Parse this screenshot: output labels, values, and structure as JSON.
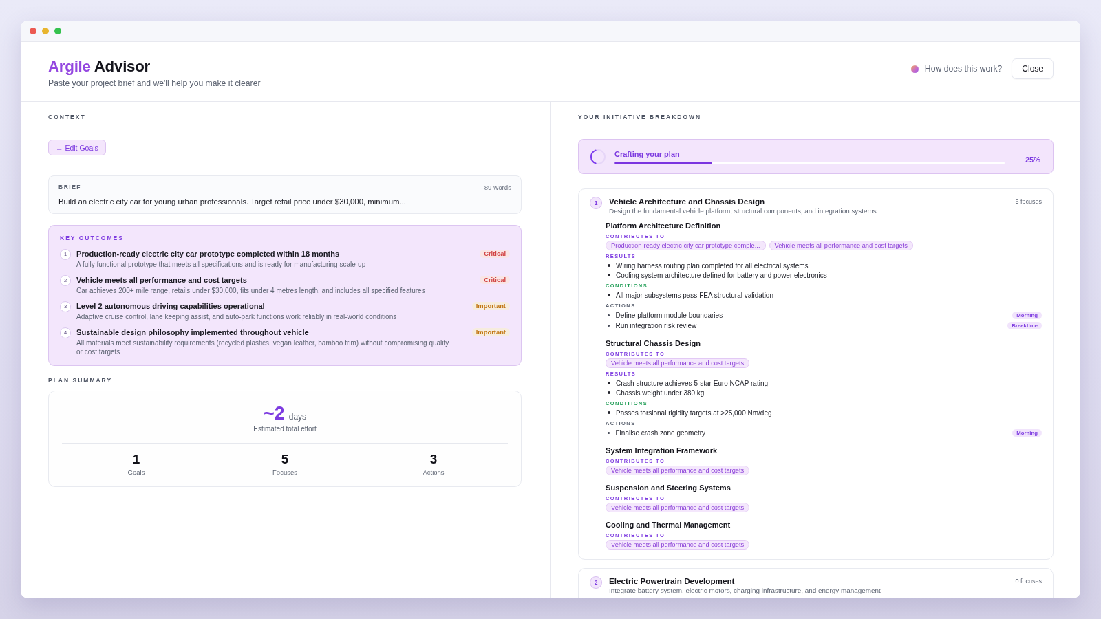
{
  "window": {
    "controls": [
      {
        "color": "#ec5a52"
      },
      {
        "color": "#e8b52e"
      },
      {
        "color": "#35c24e"
      }
    ]
  },
  "header": {
    "title_accent": "Argile",
    "title": "Advisor",
    "subtitle": "Paste your project brief and we'll help you make it clearer",
    "help_link": "How does this work?",
    "close_button": "Close"
  },
  "context": {
    "heading": "CONTEXT",
    "edit_button": "← Edit Goals",
    "brief": {
      "label": "BRIEF",
      "word_count": "89 words",
      "text": "Build an electric city car for young urban professionals. Target retail price under $30,000, minimum..."
    },
    "outcomes": {
      "heading": "KEY OUTCOMES",
      "items": [
        {
          "number": "1",
          "title": "Production-ready electric city car prototype completed within 18 months",
          "description": "A fully functional prototype that meets all specifications and is ready for manufacturing scale-up",
          "priority": "Critical",
          "color": "#d14343"
        },
        {
          "number": "2",
          "title": "Vehicle meets all performance and cost targets",
          "description": "Car achieves 200+ mile range, retails under $30,000, fits under 4 metres length, and includes all specified features",
          "priority": "Critical",
          "color": "#d14343"
        },
        {
          "number": "3",
          "title": "Level 2 autonomous driving capabilities operational",
          "description": "Adaptive cruise control, lane keeping assist, and auto-park functions work reliably in real-world conditions",
          "priority": "Important",
          "color": "#c27612"
        },
        {
          "number": "4",
          "title": "Sustainable design philosophy implemented throughout vehicle",
          "description": "All materials meet sustainability requirements (recycled plastics, vegan leather, bamboo trim) without compromising quality or cost targets",
          "priority": "Important",
          "color": "#c27612"
        }
      ]
    },
    "plan_summary": {
      "heading": "PLAN SUMMARY",
      "effort_value": "~2",
      "effort_unit": "days",
      "effort_label": "Estimated total effort",
      "stats": [
        {
          "value": "1",
          "label": "Goals"
        },
        {
          "value": "5",
          "label": "Focuses"
        },
        {
          "value": "3",
          "label": "Actions"
        }
      ]
    }
  },
  "breakdown": {
    "heading": "YOUR INITIATIVE BREAKDOWN",
    "progress": {
      "label": "Crafting your plan",
      "level": 0.25,
      "reading": "25%"
    },
    "goals": [
      {
        "number": "1",
        "title": "Vehicle Architecture and Chassis Design",
        "description": "Design the fundamental vehicle platform, structural components, and integration systems",
        "focus_count": "5 focuses",
        "focuses": [
          {
            "title": "Platform Architecture Definition",
            "sections": [
              {
                "kind": "contributes",
                "label": "CONTRIBUTES TO",
                "chips": [
                  "Production-ready electric city car prototype comple...",
                  "Vehicle meets all performance and cost targets"
                ]
              },
              {
                "kind": "results",
                "label": "RESULTS",
                "items": [
                  "Wiring harness routing plan completed for all electrical systems",
                  "Cooling system architecture defined for battery and power electronics"
                ]
              },
              {
                "kind": "conditions",
                "label": "CONDITIONS",
                "items": [
                  "All major subsystems pass FEA structural validation"
                ]
              },
              {
                "kind": "actions",
                "label": "ACTIONS",
                "items": [
                  {
                    "text": "Define platform module boundaries",
                    "time": "Morning"
                  },
                  {
                    "text": "Run integration risk review",
                    "time": "Breaktime"
                  }
                ]
              }
            ]
          },
          {
            "title": "Structural Chassis Design",
            "sections": [
              {
                "kind": "contributes",
                "label": "CONTRIBUTES TO",
                "chips": [
                  "Vehicle meets all performance and cost targets"
                ]
              },
              {
                "kind": "results",
                "label": "RESULTS",
                "items": [
                  "Crash structure achieves 5-star Euro NCAP rating",
                  "Chassis weight under 380 kg"
                ]
              },
              {
                "kind": "conditions",
                "label": "CONDITIONS",
                "items": [
                  "Passes torsional rigidity targets at >25,000 Nm/deg"
                ]
              },
              {
                "kind": "actions",
                "label": "ACTIONS",
                "items": [
                  {
                    "text": "Finalise crash zone geometry",
                    "time": "Morning"
                  }
                ]
              }
            ]
          },
          {
            "title": "System Integration Framework",
            "sections": [
              {
                "kind": "contributes",
                "label": "CONTRIBUTES TO",
                "chips": [
                  "Vehicle meets all performance and cost targets"
                ]
              }
            ]
          },
          {
            "title": "Suspension and Steering Systems",
            "sections": [
              {
                "kind": "contributes",
                "label": "CONTRIBUTES TO",
                "chips": [
                  "Vehicle meets all performance and cost targets"
                ]
              }
            ]
          },
          {
            "title": "Cooling and Thermal Management",
            "sections": [
              {
                "kind": "contributes",
                "label": "CONTRIBUTES TO",
                "chips": [
                  "Vehicle meets all performance and cost targets"
                ]
              }
            ]
          }
        ]
      },
      {
        "number": "2",
        "title": "Electric Powertrain Development",
        "description": "Integrate battery system, electric motors, charging infrastructure, and energy management",
        "focus_count": "0 focuses"
      }
    ]
  }
}
